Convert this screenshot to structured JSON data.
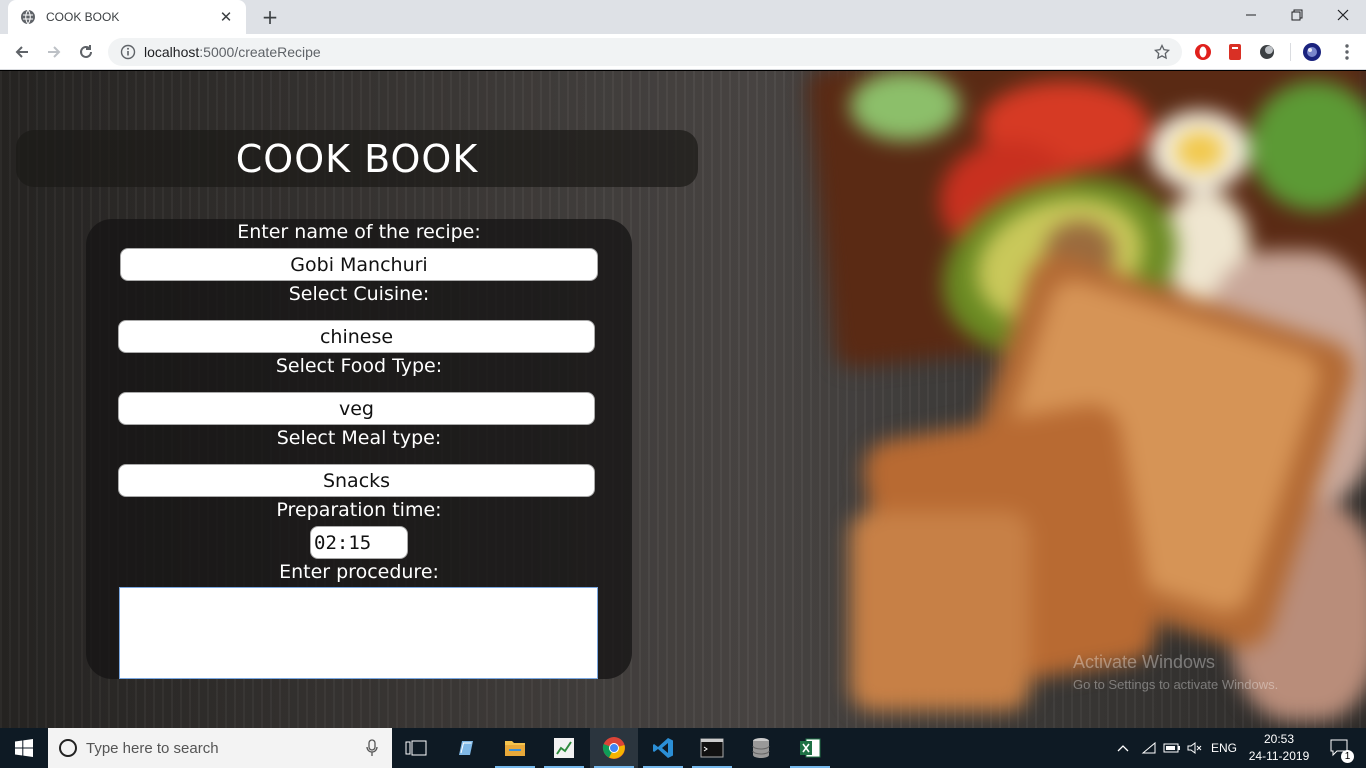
{
  "browser": {
    "tab_title": "COOK BOOK",
    "tab_close": "✕",
    "new_tab": "+",
    "url_host": "localhost",
    "url_path": ":5000/createRecipe"
  },
  "page": {
    "title": "COOK BOOK",
    "recipe_name_label": "Enter name of the recipe:",
    "recipe_name_value": "Gobi Manchuri",
    "cuisine_label": "Select Cuisine:",
    "cuisine_value": "chinese",
    "food_type_label": "Select Food Type:",
    "food_type_value": "veg",
    "meal_type_label": "Select Meal type:",
    "meal_type_value": "Snacks",
    "prep_time_label": "Preparation time:",
    "prep_time_value": "02:15",
    "procedure_label": "Enter procedure:",
    "procedure_value": ""
  },
  "watermark": {
    "line1": "Activate Windows",
    "line2": "Go to Settings to activate Windows."
  },
  "taskbar": {
    "search_placeholder": "Type here to search",
    "language": "ENG",
    "time": "20:53",
    "date": "24-11-2019",
    "notification_count": "1"
  },
  "colors": {
    "accent_blue": "#1a73e8",
    "taskbar": "#0e1a24"
  }
}
